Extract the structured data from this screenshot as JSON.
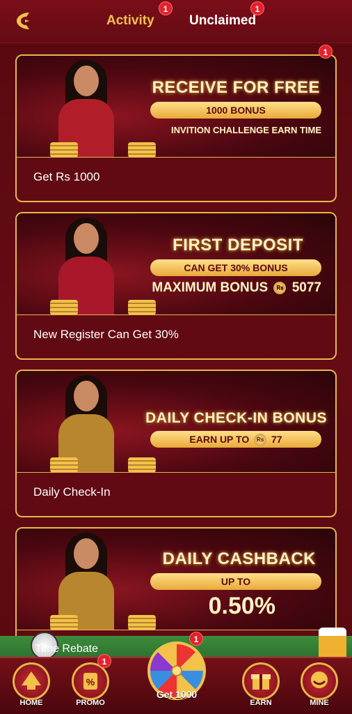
{
  "header": {
    "tabs": [
      {
        "label": "Activity",
        "badge": "1"
      },
      {
        "label": "Unclaimed",
        "badge": "1"
      }
    ]
  },
  "cards": [
    {
      "badge": "1",
      "title": "RECEIVE FOR FREE",
      "pill": "1000 BONUS",
      "subtitle": "INVITION CHALLENGE EARN TIME",
      "caption": "Get Rs 1000"
    },
    {
      "title": "FIRST DEPOSIT",
      "pill": "CAN GET 30% BONUS",
      "subtitle_prefix": "MAXIMUM BONUS",
      "coin_label": "Rs",
      "subtitle_value": "5077",
      "caption": "New Register Can Get 30%"
    },
    {
      "title": "DAILY CHECK-IN BONUS",
      "pill_prefix": "EARN UP TO",
      "coin_label": "Rs",
      "pill_value": "77",
      "caption": "Daily Check-In"
    },
    {
      "title": "DAILY CASHBACK",
      "pill": "UP TO",
      "subtitle": "0.50%",
      "caption": "Time Rebate"
    }
  ],
  "bottom_nav": {
    "items": [
      {
        "label": "HOME",
        "icon": "home-icon"
      },
      {
        "label": "PROMO",
        "icon": "promo-icon",
        "badge": "1"
      },
      {
        "label": "EARN",
        "icon": "gift-icon"
      },
      {
        "label": "MINE",
        "icon": "user-icon"
      }
    ],
    "wheel": {
      "label": "Get 1000",
      "badge": "1"
    }
  },
  "colors": {
    "accent_gold": "#f2c24a",
    "background": "#5e0a12",
    "badge_red": "#e3222d"
  }
}
